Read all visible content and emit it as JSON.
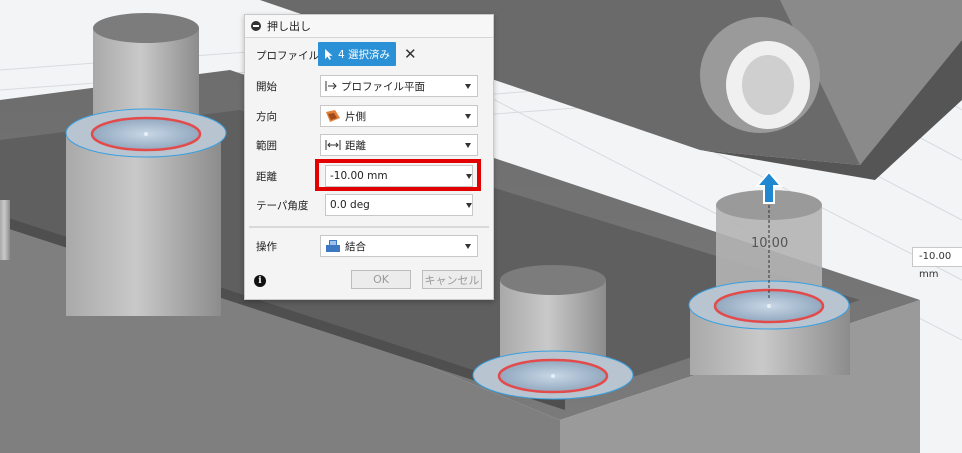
{
  "dialog": {
    "title": "押し出し",
    "rows": {
      "profile": {
        "label": "プロファイル",
        "button": "4 選択済み"
      },
      "start": {
        "label": "開始",
        "value": "プロファイル平面"
      },
      "direction": {
        "label": "方向",
        "value": "片側"
      },
      "extent": {
        "label": "範囲",
        "value": "距離"
      },
      "distance": {
        "label": "距離",
        "value": "-10.00 mm"
      },
      "taper": {
        "label": "テーパ角度",
        "value": "0.0 deg"
      },
      "operation": {
        "label": "操作",
        "value": "結合"
      }
    },
    "ok_label": "OK",
    "cancel_label": "キャンセル"
  },
  "viewport": {
    "dimension_input": "-10.00 mm",
    "dimension_text": "10.00"
  },
  "colors": {
    "accent": "#2b91d6",
    "highlight": "#e30000",
    "model_gray": "#8f8f8f",
    "selection_red": "#e34b4b",
    "manipulator": "#1f88d0"
  },
  "icons": [
    "cursor-icon",
    "close-icon",
    "start-plane-icon",
    "direction-icon",
    "extent-distance-icon",
    "combine-icon",
    "info-icon",
    "arrow-manipulator-icon"
  ]
}
